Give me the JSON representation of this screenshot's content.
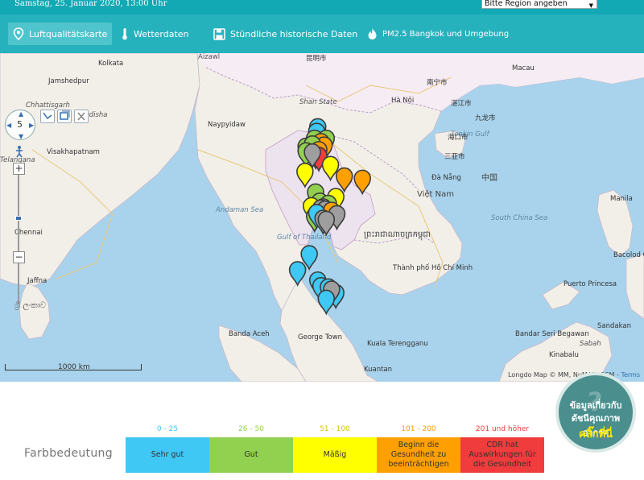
{
  "header": {
    "date": "Samstag, 25. Januar 2020, 13:00 Uhr",
    "region_select": "Bitte Region angeben"
  },
  "nav": {
    "items": [
      {
        "label": "Luftqualitätskarte",
        "icon": "location-pin-icon",
        "active": true
      },
      {
        "label": "Wetterdaten",
        "icon": "thermometer-icon",
        "active": false
      },
      {
        "label": "Stündliche historische Daten",
        "icon": "floppy-disk-icon",
        "active": false
      },
      {
        "label": "PM2.5 Bangkok und Umgebung",
        "icon": "flame-icon",
        "active": false
      }
    ]
  },
  "map": {
    "zoom_level": "5",
    "scale": "1000 km",
    "attribution": "Longdo Map © MM, NuMAP, OSM",
    "attribution_link": "Terms",
    "labels": {
      "aizawl": "Aizawl",
      "kunming": "昆明市",
      "nanning": "南宁市",
      "hanoi": "Hà Nội",
      "shan": "Shan State",
      "naypyidaw": "Naypyidaw",
      "vietnam": "Việt Nam",
      "danang": "Đà Nẵng",
      "cambodia": "ព្រះរាជាណាចក្រកម្ពុជា",
      "hcmc": "Thành phố Hồ Chí Minh",
      "visakhapatnam": "Visakhapatnam",
      "chennai": "Chennai",
      "jaffna": "Jaffna",
      "srilanka": "ශ්‍රී ලංකාව",
      "banda_aceh": "Banda Aceh",
      "george_town": "George Town",
      "kuala_terengganu": "Kuala Terengganu",
      "kuantan": "Kuantan",
      "manila": "Manila",
      "puerto_princesa": "Puerto Princesa",
      "bandar": "Bandar Seri Begawan",
      "macau": "Macau",
      "jamshedpur": "Jamshedpur",
      "odisha": "Odisha",
      "chhattisgarh": "Chhattisgarh",
      "telangana": "Telangana",
      "tonkin": "Tonkin Gulf",
      "andaman": "Andaman Sea",
      "south_china": "South China Sea",
      "gulf_thailand": "Gulf of Thailand",
      "sabah": "Sabah",
      "kinabalu": "Kinabalu",
      "sandakan": "Sandakan",
      "bacolod": "Bacolod City",
      "taipei_area": "九龙市",
      "sanya": "三亚市",
      "kolkata": "Kolkata",
      "haikou": "海口市",
      "zhanjiang": "湛江市",
      "china": "中国"
    }
  },
  "legend": {
    "title": "Farbbedeutung",
    "categories": [
      {
        "range": "0 - 25",
        "label": "Sehr gut",
        "color": "#3fc8f4",
        "range_color": "#3fc8f4"
      },
      {
        "range": "26 - 50",
        "label": "Gut",
        "color": "#92d050",
        "range_color": "#92d050"
      },
      {
        "range": "51 - 100",
        "label": "Mäßig",
        "color": "#ffff00",
        "range_color": "#d4c400"
      },
      {
        "range": "101 - 200",
        "label": "Beginn die Gesundheit zu beeinträchtigen",
        "color": "#ffa000",
        "range_color": "#ff9a00"
      },
      {
        "range": "201 und höher",
        "label": "CDR hat Auswirkungen für die Gesundheit",
        "color": "#f03c3c",
        "range_color": "#f03c3c"
      }
    ]
  },
  "info_bubble": {
    "line1": "ข้อมูลเกี่ยวกับ",
    "line2": "ดัชนีคุณภาพอากาศ",
    "line3": "คลิ๊กที่นี่"
  },
  "colors": {
    "topbar": "#12a9b4",
    "navbar": "#26b2bd",
    "water": "#a9d3ec",
    "land": "#f2efe9"
  },
  "markers": [
    {
      "lat": 20.9,
      "lon": 100.1,
      "color": "#3fc8f4"
    },
    {
      "lat": 20.5,
      "lon": 100.0,
      "color": "#3fc8f4"
    },
    {
      "lat": 19.9,
      "lon": 99.8,
      "color": "#92d050"
    },
    {
      "lat": 19.9,
      "lon": 100.9,
      "color": "#92d050"
    },
    {
      "lat": 19.2,
      "lon": 99.0,
      "color": "#92d050"
    },
    {
      "lat": 19.6,
      "lon": 100.4,
      "color": "#ffa000"
    },
    {
      "lat": 19.3,
      "lon": 100.7,
      "color": "#ffa000"
    },
    {
      "lat": 19.4,
      "lon": 99.6,
      "color": "#92d050"
    },
    {
      "lat": 18.8,
      "lon": 99.0,
      "color": "#92d050"
    },
    {
      "lat": 18.6,
      "lon": 99.9,
      "color": "#ffa000"
    },
    {
      "lat": 18.9,
      "lon": 100.2,
      "color": "#ffa000"
    },
    {
      "lat": 18.4,
      "lon": 100.2,
      "color": "#f03c3c"
    },
    {
      "lat": 18.7,
      "lon": 99.6,
      "color": "#9e9e9e"
    },
    {
      "lat": 17.6,
      "lon": 101.3,
      "color": "#ffff00"
    },
    {
      "lat": 17.0,
      "lon": 98.9,
      "color": "#ffff00"
    },
    {
      "lat": 16.6,
      "lon": 102.6,
      "color": "#ffa000"
    },
    {
      "lat": 16.4,
      "lon": 104.3,
      "color": "#ffa000"
    },
    {
      "lat": 15.2,
      "lon": 99.9,
      "color": "#92d050"
    },
    {
      "lat": 14.8,
      "lon": 101.8,
      "color": "#ffff00"
    },
    {
      "lat": 14.4,
      "lon": 100.3,
      "color": "#92d050"
    },
    {
      "lat": 14.2,
      "lon": 101.1,
      "color": "#92d050"
    },
    {
      "lat": 14.0,
      "lon": 99.5,
      "color": "#ffff00"
    },
    {
      "lat": 13.9,
      "lon": 100.6,
      "color": "#9e9e9e"
    },
    {
      "lat": 13.8,
      "lon": 100.4,
      "color": "#9e9e9e"
    },
    {
      "lat": 13.7,
      "lon": 100.8,
      "color": "#9e9e9e"
    },
    {
      "lat": 13.6,
      "lon": 101.4,
      "color": "#ffa000"
    },
    {
      "lat": 13.3,
      "lon": 101.9,
      "color": "#9e9e9e"
    },
    {
      "lat": 13.1,
      "lon": 99.8,
      "color": "#92d050"
    },
    {
      "lat": 13.4,
      "lon": 100.0,
      "color": "#3fc8f4"
    },
    {
      "lat": 12.9,
      "lon": 100.6,
      "color": "#9e9e9e"
    },
    {
      "lat": 12.8,
      "lon": 100.9,
      "color": "#9e9e9e"
    },
    {
      "lat": 9.8,
      "lon": 99.3,
      "color": "#3fc8f4"
    },
    {
      "lat": 8.4,
      "lon": 98.2,
      "color": "#3fc8f4"
    },
    {
      "lat": 7.5,
      "lon": 100.1,
      "color": "#3fc8f4"
    },
    {
      "lat": 7.0,
      "lon": 100.4,
      "color": "#3fc8f4"
    },
    {
      "lat": 6.9,
      "lon": 101.1,
      "color": "#3fc8f4"
    },
    {
      "lat": 6.4,
      "lon": 101.8,
      "color": "#3fc8f4"
    },
    {
      "lat": 6.7,
      "lon": 101.4,
      "color": "#9e9e9e"
    },
    {
      "lat": 5.9,
      "lon": 100.9,
      "color": "#3fc8f4"
    }
  ]
}
